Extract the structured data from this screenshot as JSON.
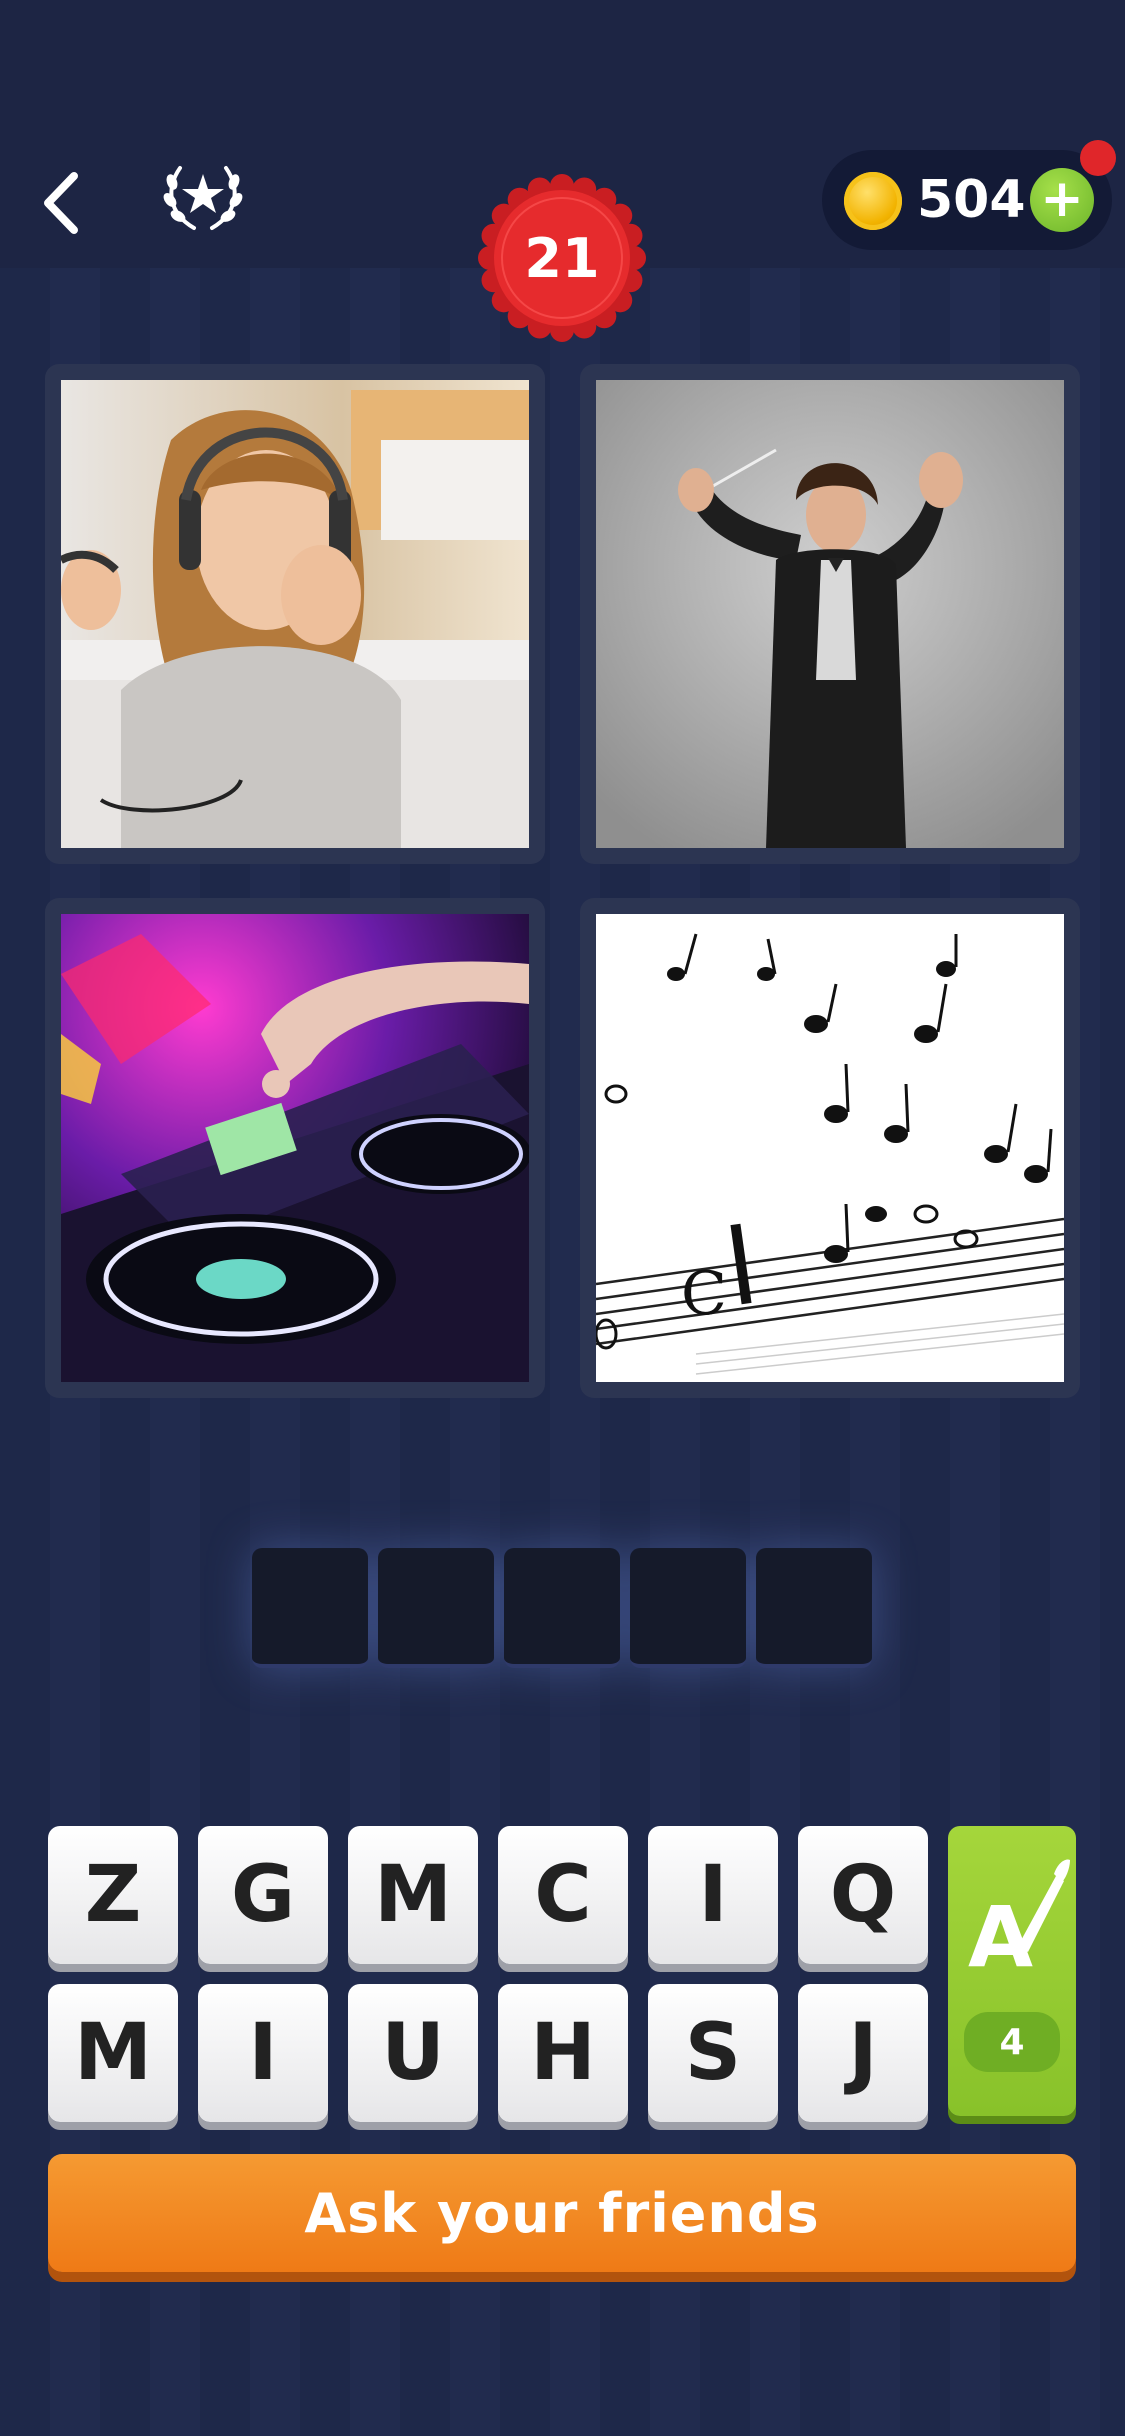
{
  "header": {
    "level": "21",
    "coins": "504",
    "plus_label": "+"
  },
  "photos": [
    {
      "name": "woman-with-headphones"
    },
    {
      "name": "orchestra-conductor"
    },
    {
      "name": "dj-turntables"
    },
    {
      "name": "music-notes-sheet"
    }
  ],
  "answer": {
    "slots": 5
  },
  "keyboard": {
    "row1": [
      "Z",
      "G",
      "M",
      "C",
      "I",
      "Q"
    ],
    "row2": [
      "M",
      "I",
      "U",
      "H",
      "S",
      "J"
    ]
  },
  "hint": {
    "count": "4"
  },
  "ask_button": {
    "label": "Ask your friends"
  },
  "colors": {
    "background": "#1e2849",
    "level_badge": "#e0262a",
    "hint_green": "#9ccf35",
    "ask_orange": "#f08a22"
  }
}
